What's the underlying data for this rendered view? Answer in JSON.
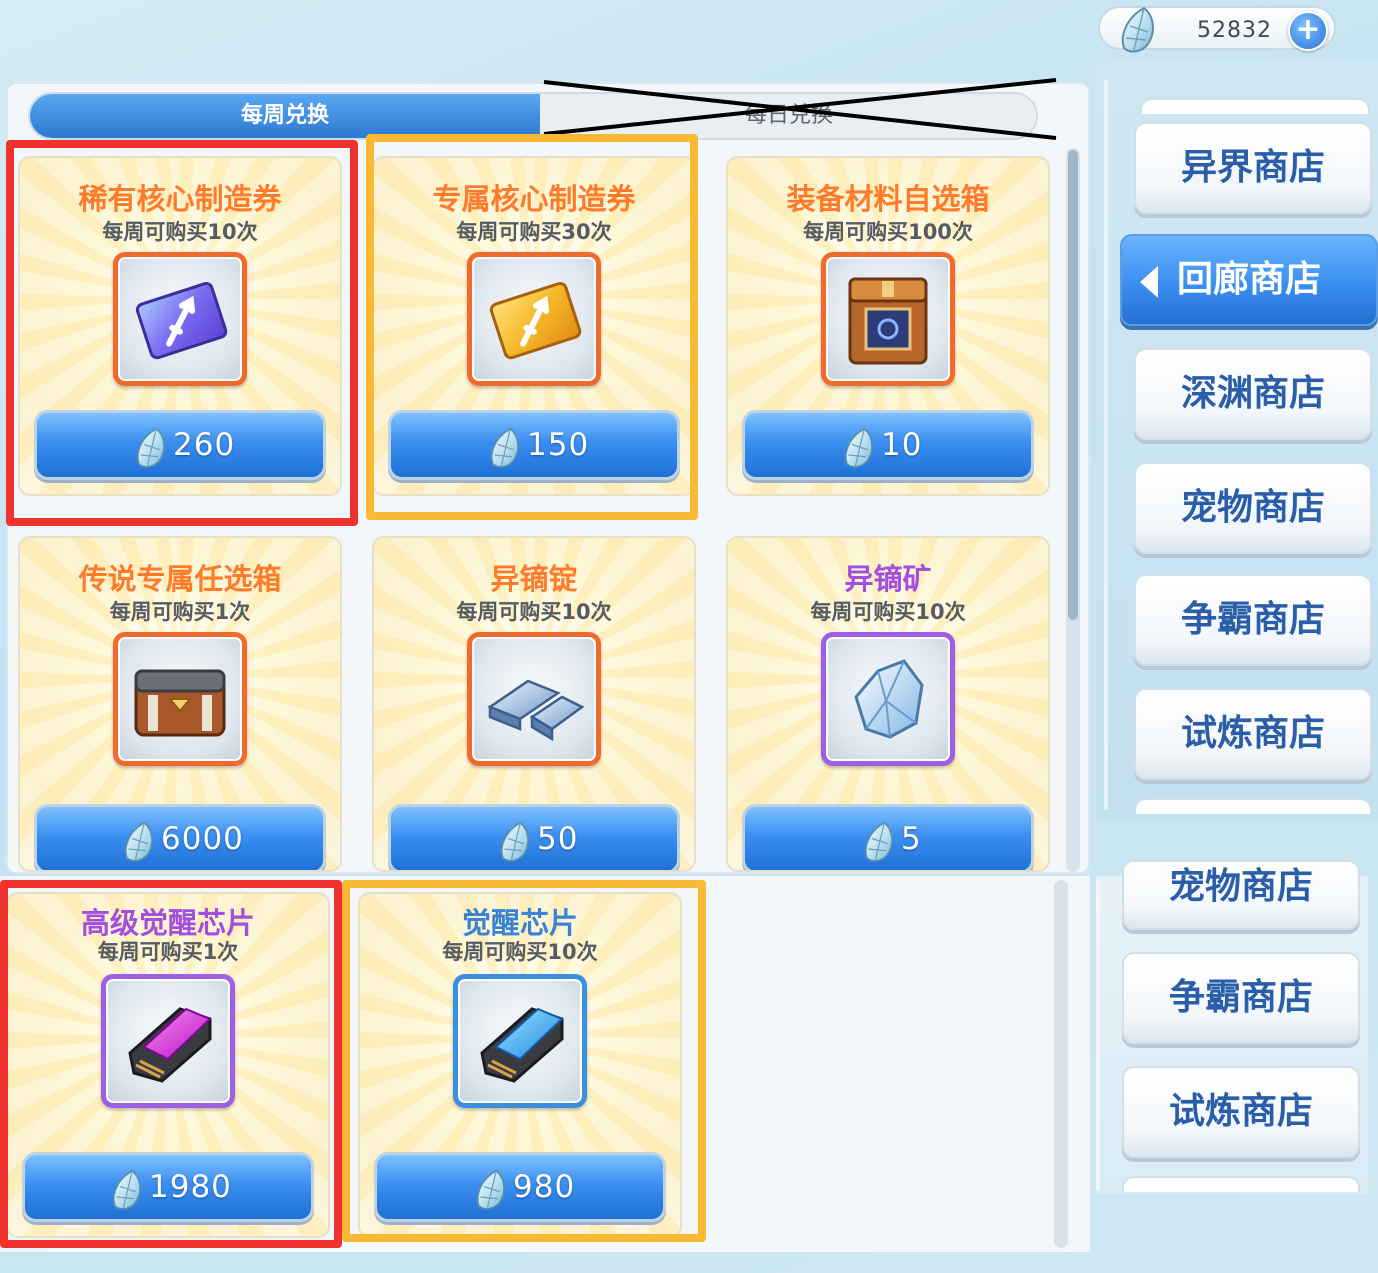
{
  "currency": {
    "amount": "52832",
    "plus": "+"
  },
  "tabs": [
    {
      "label": "每周兑换",
      "active": true
    },
    {
      "label": "每日兑换",
      "active": false
    }
  ],
  "items": [
    {
      "name": "稀有核心制造券",
      "limit": "每周可购买10次",
      "price": "260",
      "icon": "rare-core-ticket-icon"
    },
    {
      "name": "专属核心制造券",
      "limit": "每周可购买30次",
      "price": "150",
      "icon": "exclusive-core-ticket-icon"
    },
    {
      "name": "装备材料自选箱",
      "limit": "每周可购买100次",
      "price": "10",
      "icon": "equipment-material-box-icon"
    },
    {
      "name": "传说专属任选箱",
      "limit": "每周可购买1次",
      "price": "6000",
      "icon": "legendary-exclusive-box-icon"
    },
    {
      "name": "异镝锭",
      "limit": "每周可购买10次",
      "price": "50",
      "icon": "ingot-icon"
    },
    {
      "name": "异镝矿",
      "limit": "每周可购买10次",
      "price": "5",
      "icon": "ore-crystal-icon"
    },
    {
      "name": "高级觉醒芯片",
      "limit": "每周可购买1次",
      "price": "1980",
      "icon": "advanced-awakening-chip-icon"
    },
    {
      "name": "觉醒芯片",
      "limit": "每周可购买10次",
      "price": "980",
      "icon": "awakening-chip-icon"
    }
  ],
  "sidebar": {
    "items": [
      "异界商店",
      "回廊商店",
      "深渊商店",
      "宠物商店",
      "争霸商店",
      "试炼商店"
    ],
    "active": "回廊商店",
    "lower_items": [
      "宠物商店",
      "争霸商店",
      "试炼商店"
    ]
  },
  "colors": {
    "highlight_red": "#f0322e",
    "highlight_yellow": "#f9b934",
    "button_blue": "#3b8ff0",
    "title_orange": "#ff7a2a"
  }
}
